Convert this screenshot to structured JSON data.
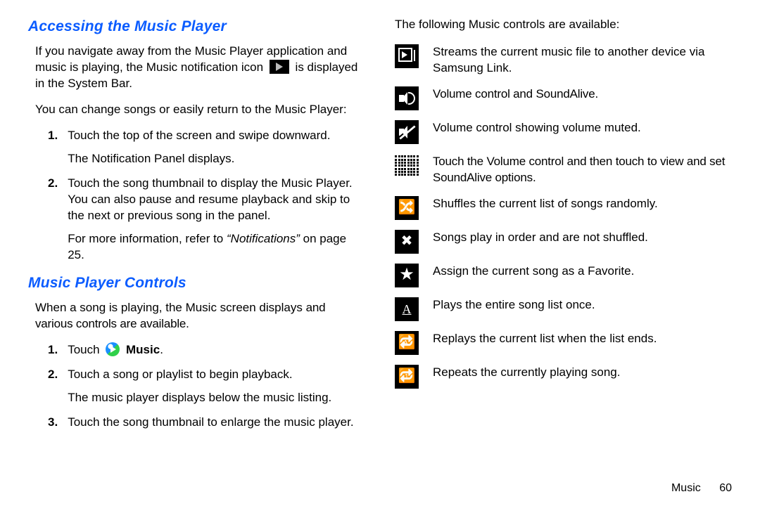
{
  "left": {
    "heading_access": "Accessing the Music Player",
    "access_p1_pre": "If you navigate away from the Music Player application and music is playing, the Music notification icon ",
    "access_p1_post": " is displayed in the System Bar.",
    "access_p2": "You can change songs or easily return to the Music Player:",
    "steps_a": [
      {
        "num": "1.",
        "line1": "Touch the top of the screen and swipe downward.",
        "line2": "The Notification Panel displays."
      },
      {
        "num": "2.",
        "line1": "Touch the song thumbnail to display the Music Player. You can also pause and resume playback and skip to the next or previous song in the panel.",
        "line2_pre": "For more information, refer to ",
        "line2_ital": "“Notifications”",
        "line2_post": " on page 25."
      }
    ],
    "heading_controls": "Music Player Controls",
    "controls_p1_pre": "When a song is playing, the Music screen displays ",
    "controls_p1_cond": "and various controls are available.",
    "steps_b": [
      {
        "num": "1.",
        "line1_pre": "Touch ",
        "line1_bold": "Music",
        "line1_post": "."
      },
      {
        "num": "2.",
        "line1": "Touch a song or playlist to begin playback.",
        "line2": "The music player displays below the music listing."
      },
      {
        "num": "3.",
        "line1": "Touch the song thumbnail to enlarge the music player."
      }
    ]
  },
  "right": {
    "intro": "The following Music controls are available:",
    "rows": [
      {
        "icon": "stream-icon",
        "text": "Streams the current music file to another device via Samsung Link."
      },
      {
        "icon": "volume-icon",
        "text": "Volume control and SoundAlive."
      },
      {
        "icon": "mute-icon",
        "text": "Volume control showing volume muted."
      },
      {
        "icon": "equalizer-icon",
        "text": "Touch the Volume control and then touch to view and set SoundAlive options."
      },
      {
        "icon": "shuffle-on-icon",
        "text": "Shuffles the current list of songs randomly."
      },
      {
        "icon": "shuffle-off-icon",
        "text": "Songs play in order and are not shuffled."
      },
      {
        "icon": "favorite-star-icon",
        "text": "Assign the current song as a Favorite."
      },
      {
        "icon": "play-once-icon",
        "text": "Plays the entire song list once."
      },
      {
        "icon": "repeat-all-icon",
        "text": "Replays the current list when the list ends."
      },
      {
        "icon": "repeat-one-icon",
        "text": "Repeats the currently playing song."
      }
    ]
  },
  "footer": {
    "section": "Music",
    "page": "60"
  }
}
